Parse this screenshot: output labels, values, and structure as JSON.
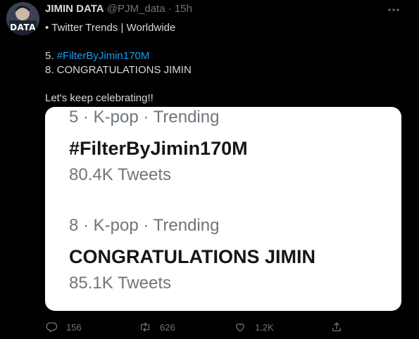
{
  "tweet": {
    "author_name": "JIMIN DATA",
    "author_handle": "@PJM_data",
    "separator": "·",
    "time": "15h",
    "avatar_text": "DATA",
    "lines": [
      "• Twitter Trends | Worldwide",
      "",
      "5. ",
      "8. CONGRATULATIONS JIMIN",
      "",
      "Let's keep celebrating!!"
    ],
    "line5_prefix": "5. ",
    "line5_hashtag": "#FilterByJimin170M",
    "line1": "• Twitter Trends | Worldwide",
    "line8": "8. CONGRATULATIONS JIMIN",
    "closing": "Let's keep celebrating!!"
  },
  "media": {
    "trends": [
      {
        "meta": "5 · K-pop · Trending",
        "name": "#FilterByJimin170M",
        "count": "80.4K Tweets"
      },
      {
        "meta": "8 · K-pop · Trending",
        "name": "CONGRATULATIONS JIMIN",
        "count": "85.1K Tweets"
      }
    ]
  },
  "actions": {
    "replies": "156",
    "retweets": "626",
    "likes": "1.2K"
  },
  "colors": {
    "background": "#000000",
    "hashtag": "#1d9bf0",
    "muted": "#6e767d"
  },
  "icons": [
    "more-icon",
    "reply-icon",
    "retweet-icon",
    "like-icon",
    "share-icon"
  ]
}
